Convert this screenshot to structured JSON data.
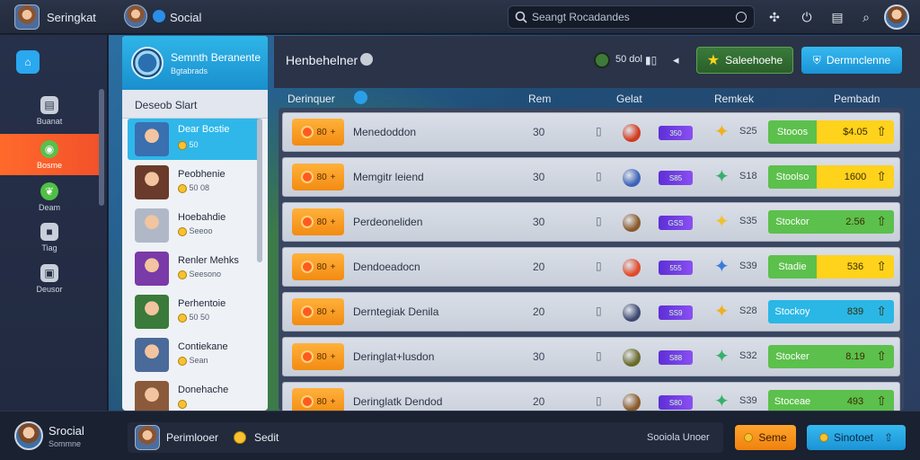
{
  "topbar": {
    "app_name": "Seringkat",
    "social_label": "Social",
    "search_placeholder": "Seangt Rocadandes",
    "icons": [
      "settings-icon",
      "share-icon",
      "power-icon",
      "wallet-icon",
      "search-icon"
    ]
  },
  "sidebar": {
    "items": [
      {
        "label": "",
        "icon": "home-icon"
      },
      {
        "label": "Buanat",
        "icon": "document-icon"
      },
      {
        "label": "Bosme",
        "icon": "game-icon",
        "active": true
      },
      {
        "label": "Deam",
        "icon": "leaf-icon"
      },
      {
        "label": "Tiag",
        "icon": "cube-icon"
      },
      {
        "label": "Deusor",
        "icon": "box-icon"
      }
    ]
  },
  "friend_panel": {
    "title": "Semnth Beranente",
    "subtitle": "Bgtabrads",
    "section_label": "Deseob Slart",
    "friends": [
      {
        "name": "Dear Bostie",
        "coins": "50"
      },
      {
        "name": "Peobhenie",
        "coins": "50 08"
      },
      {
        "name": "Hoebahdie",
        "coins": "Seeoo"
      },
      {
        "name": "Renler Mehks",
        "coins": "Seesono"
      },
      {
        "name": "Perhentoie",
        "coins": "50 50"
      },
      {
        "name": "Contiekane",
        "coins": "Sean"
      },
      {
        "name": "Donehache",
        "coins": ""
      }
    ]
  },
  "main": {
    "title": "Henbehelner",
    "status_value": "50 dol",
    "buttons": {
      "green": "Saleehoehe",
      "blue": "Dermnclenne"
    },
    "columns": {
      "player": "Derinquer",
      "rank": "Rem",
      "goal": "Gelat",
      "remark": "Remkek",
      "pember": "Pembadn"
    },
    "rows": [
      {
        "level": "80",
        "name": "Menedoddon",
        "rank": "30",
        "orb_color": "#d23a1f",
        "gem": "350",
        "star_color": "#f0b020",
        "count": "S25",
        "action": "Stooos",
        "value": "$4.05",
        "value_color": "#ffd21c",
        "action_color": "#5cc04c"
      },
      {
        "level": "80",
        "name": "Memgitr leiend",
        "rank": "30",
        "orb_color": "#3e63b8",
        "gem": "S85",
        "star_color": "#37b06a",
        "count": "S18",
        "action": "Stoolso",
        "value": "1600",
        "value_color": "#ffd21c",
        "action_color": "#5cc04c"
      },
      {
        "level": "80",
        "name": "Perdeoneliden",
        "rank": "30",
        "orb_color": "#8a5a2a",
        "gem": "GSS",
        "star_color": "#f0c030",
        "count": "S35",
        "action": "Stockor",
        "value": "2.56",
        "value_color": "#5cc04c",
        "action_color": "#5cc04c"
      },
      {
        "level": "80",
        "name": "Dendoeadocn",
        "rank": "20",
        "orb_color": "#e04a2a",
        "gem": "555",
        "star_color": "#3a7ad8",
        "count": "S39",
        "action": "Stadie",
        "value": "536",
        "value_color": "#ffd21c",
        "action_color": "#5cc04c"
      },
      {
        "level": "80",
        "name": "Derntegiak Denila",
        "rank": "20",
        "orb_color": "#3e4a72",
        "gem": "SS9",
        "star_color": "#f0b020",
        "count": "S28",
        "action": "Stockoy",
        "value": "839",
        "value_color": "#2ab7e6",
        "action_color": "#2ab7e6"
      },
      {
        "level": "80",
        "name": "Deringlat+lusdon",
        "rank": "30",
        "orb_color": "#6a6a2a",
        "gem": "S88",
        "star_color": "#37b06a",
        "count": "S32",
        "action": "Stocker",
        "value": "8.19",
        "value_color": "#5cc04c",
        "action_color": "#5cc04c"
      },
      {
        "level": "80",
        "name": "Deringlatk Dendod",
        "rank": "20",
        "orb_color": "#8a5a2a",
        "gem": "S80",
        "star_color": "#37b06a",
        "count": "S39",
        "action": "Stoceae",
        "value": "493",
        "value_color": "#5cc04c",
        "action_color": "#5cc04c"
      }
    ]
  },
  "bottombar": {
    "profile_name": "Srocial",
    "profile_sub": "Sommne",
    "friend_label": "Perimlooer",
    "coin_label": "Sedit",
    "status_text": "Sooiola Unoer",
    "orange_button": "Seme",
    "blue_button": "Sinotoet"
  }
}
